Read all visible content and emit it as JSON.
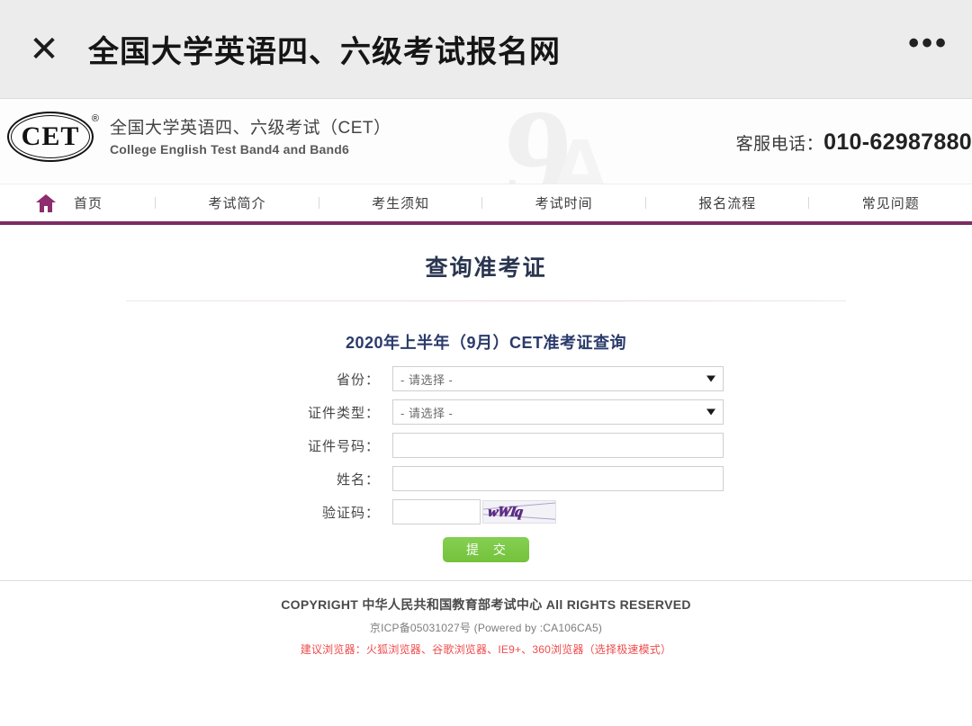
{
  "browser_chrome": {
    "close_icon": "close-icon",
    "title": "全国大学英语四、六级考试报名网",
    "menu_icon": "•••"
  },
  "site_header": {
    "logo_text": "CET",
    "logo_reg": "®",
    "brand_cn": "全国大学英语四、六级考试（CET）",
    "brand_en": "College English Test Band4 and Band6",
    "watermark": "9",
    "watermark2": "A",
    "service_label": "客服电话：",
    "service_number": "010-62987880"
  },
  "nav": {
    "home_icon": "home-icon",
    "items": [
      {
        "label": "首页"
      },
      {
        "label": "考试简介"
      },
      {
        "label": "考生须知"
      },
      {
        "label": "考试时间"
      },
      {
        "label": "报名流程"
      },
      {
        "label": "常见问题"
      }
    ],
    "accent_color": "#7b2c63"
  },
  "main": {
    "page_title": "查询准考证",
    "form_title": "2020年上半年（9月）CET准考证查询",
    "fields": [
      {
        "label": "省份：",
        "type": "select",
        "value": "- 请选择 -"
      },
      {
        "label": "证件类型：",
        "type": "select",
        "value": "- 请选择 -"
      },
      {
        "label": "证件号码：",
        "type": "text",
        "value": "",
        "placeholder": ""
      },
      {
        "label": "姓名：",
        "type": "text",
        "value": "",
        "placeholder": ""
      },
      {
        "label": "验证码：",
        "type": "captcha",
        "value": "",
        "placeholder": ""
      }
    ],
    "captcha_text": "wWIq",
    "submit_label": "提 交",
    "submit_color": "#7ac943"
  },
  "footer": {
    "copyright": "COPYRIGHT 中华人民共和国教育部考试中心 All RIGHTS RESERVED",
    "icp": "京ICP备05031027号 (Powered by :CA106CA5)",
    "browser_tip": "建议浏览器：火狐浏览器、谷歌浏览器、IE9+、360浏览器（选择极速模式）",
    "tip_color": "#f04b4b"
  }
}
